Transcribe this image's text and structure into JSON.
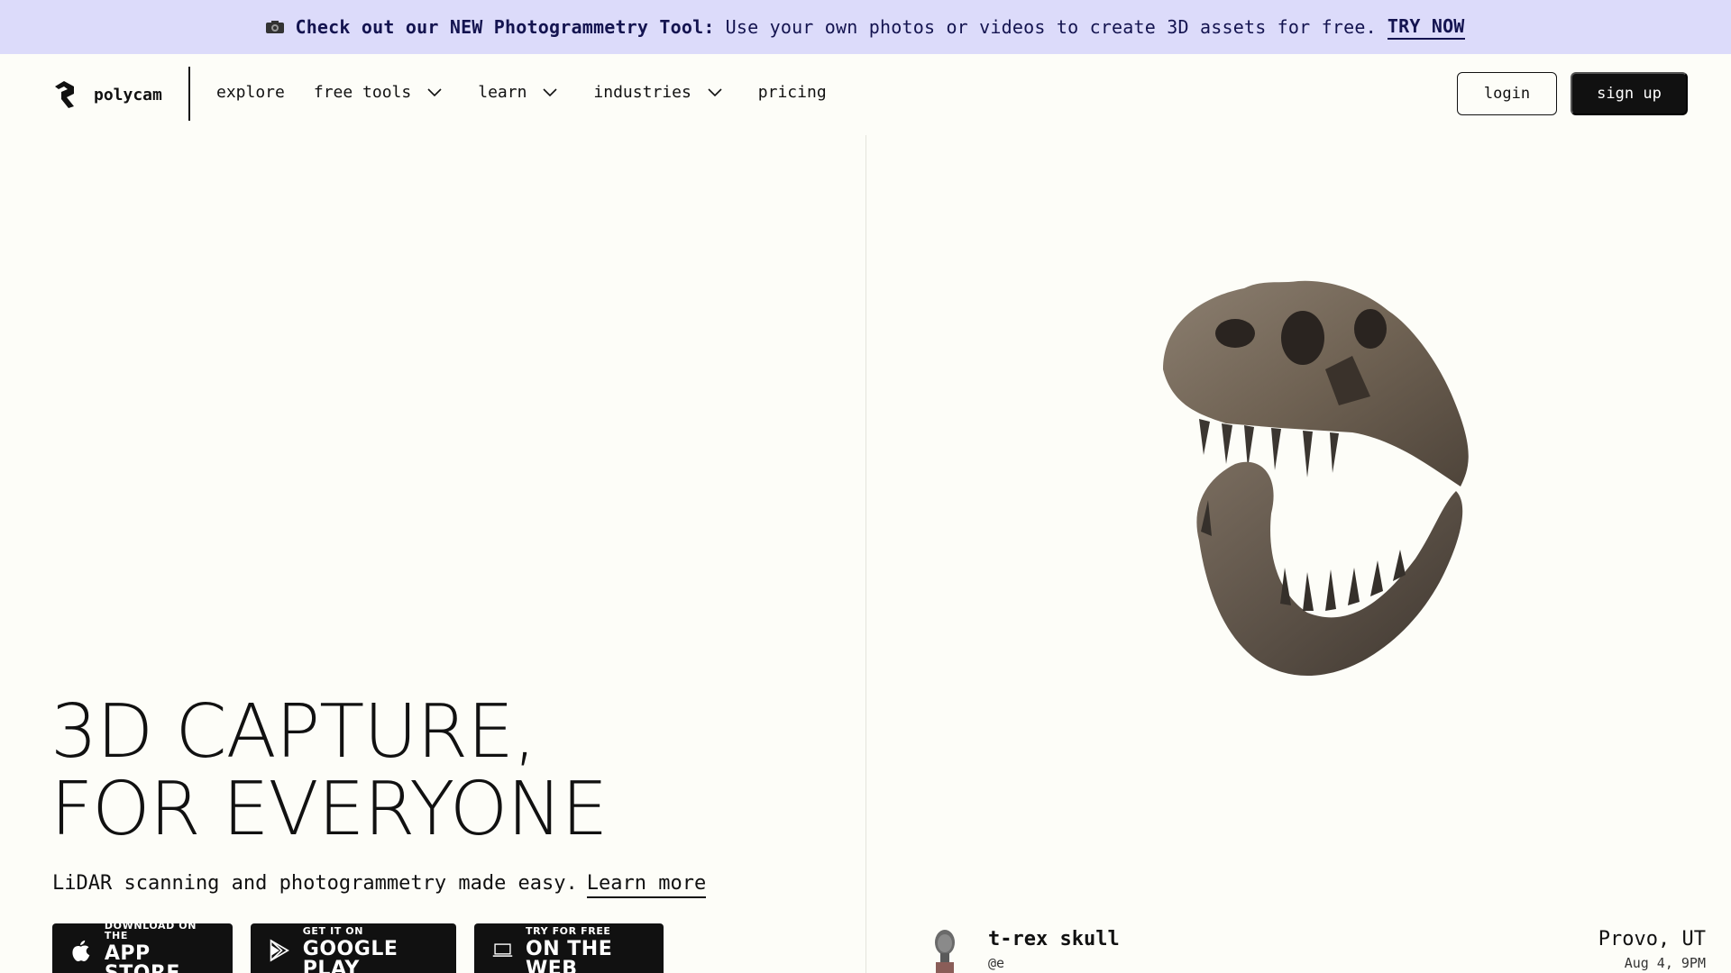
{
  "banner": {
    "icon": "camera-icon",
    "bold": "Check out our NEW Photogrammetry Tool:",
    "text": "Use your own photos or videos to create 3D assets for free.",
    "cta": "TRY NOW"
  },
  "header": {
    "logo_text": "polycam",
    "nav": {
      "explore": "explore",
      "free_tools": "free tools",
      "learn": "learn",
      "industries": "industries",
      "pricing": "pricing"
    },
    "login": "login",
    "signup": "sign up"
  },
  "hero": {
    "title_line1": "3D CAPTURE,",
    "title_line2": "FOR EVERYONE",
    "subtitle": "LiDAR scanning and photogrammetry made easy.",
    "learn_more": "Learn more"
  },
  "stores": {
    "appstore": {
      "small": "DOWNLOAD ON THE",
      "big": "APP STORE",
      "icon": "apple-icon"
    },
    "gplay": {
      "small": "GET IT ON",
      "big": "GOOGLE PLAY",
      "icon": "google-play-icon"
    },
    "web": {
      "small": "TRY FOR FREE",
      "big": "ON THE WEB",
      "icon": "laptop-icon"
    }
  },
  "model": {
    "title": "t-rex skull",
    "user": "@e",
    "location": "Provo, UT",
    "date": "Aug 4, 9PM"
  },
  "colors": {
    "banner_bg": "#dcdbfa",
    "page_bg": "#fdfdf8",
    "ink": "#111111"
  }
}
